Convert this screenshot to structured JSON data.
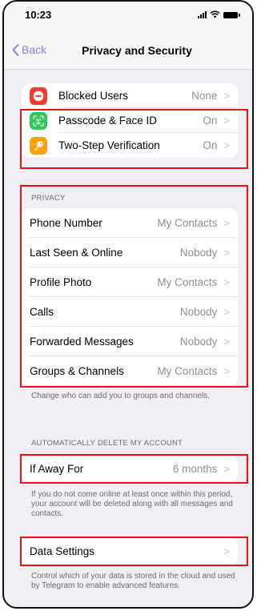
{
  "status_bar": {
    "time": "10:23"
  },
  "nav": {
    "back_label": "Back",
    "title": "Privacy and Security"
  },
  "security": [
    {
      "label": "Blocked Users",
      "value": "None",
      "icon": "minus-circle-icon",
      "color": "#ef3b30"
    },
    {
      "label": "Passcode & Face ID",
      "value": "On",
      "icon": "face-id-icon",
      "color": "#34c759"
    },
    {
      "label": "Two-Step Verification",
      "value": "On",
      "icon": "key-icon",
      "color": "#ff9f0a"
    }
  ],
  "privacy": {
    "header": "PRIVACY",
    "items": [
      {
        "label": "Phone Number",
        "value": "My Contacts"
      },
      {
        "label": "Last Seen & Online",
        "value": "Nobody"
      },
      {
        "label": "Profile Photo",
        "value": "My Contacts"
      },
      {
        "label": "Calls",
        "value": "Nobody"
      },
      {
        "label": "Forwarded Messages",
        "value": "Nobody"
      },
      {
        "label": "Groups & Channels",
        "value": "My Contacts"
      }
    ],
    "footer": "Change who can add you to groups and channels."
  },
  "auto_delete": {
    "header": "AUTOMATICALLY DELETE MY ACCOUNT",
    "label": "If Away For",
    "value": "6 months",
    "footer": "If you do not come online at least once within this period, your account will be deleted along with all messages and contacts."
  },
  "data_settings": {
    "label": "Data Settings",
    "footer": "Control which of your data is stored in the cloud and used by Telegram to enable advanced features."
  },
  "chevron": ">"
}
